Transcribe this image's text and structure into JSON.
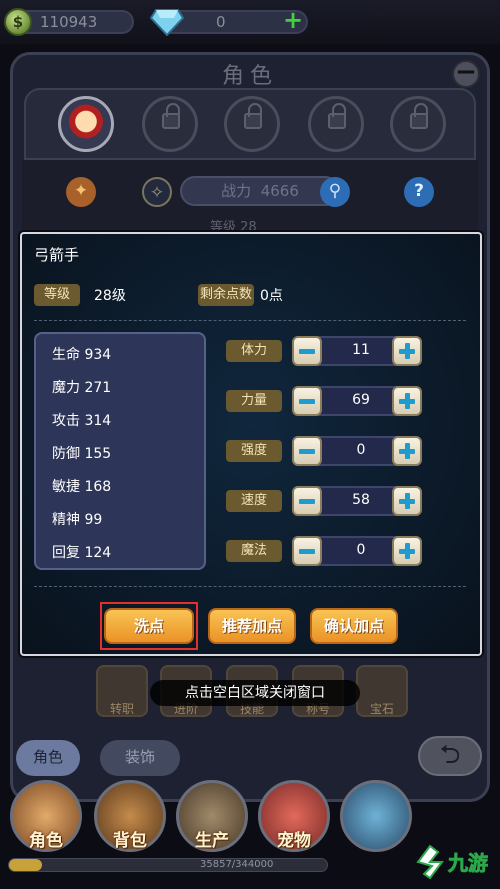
{
  "currency": {
    "gold": "110943",
    "gems": "0",
    "add": "+"
  },
  "background": {
    "title": "角色",
    "power_label": "战力",
    "power_value": "4666",
    "level_peek": "等级 28",
    "skills": [
      "转职",
      "进阶",
      "技能",
      "称号",
      "宝石"
    ],
    "tabs": {
      "character": "角色",
      "outfit": "装饰"
    },
    "nav": [
      "角色",
      "背包",
      "生产",
      "宠物"
    ],
    "exp_text": "35857/344000",
    "exp_fraction": 0.104
  },
  "modal": {
    "title": "弓箭手",
    "level_label": "等级",
    "level_value": "28级",
    "points_label": "剩余点数",
    "points_value": "0点",
    "stats": [
      {
        "text": "生命 934"
      },
      {
        "text": "魔力 271"
      },
      {
        "text": "攻击 314"
      },
      {
        "text": "防御 155"
      },
      {
        "text": "敏捷 168"
      },
      {
        "text": "精神 99"
      },
      {
        "text": "回复 124"
      }
    ],
    "attributes": [
      {
        "label": "体力",
        "value": "11"
      },
      {
        "label": "力量",
        "value": "69"
      },
      {
        "label": "强度",
        "value": "0"
      },
      {
        "label": "速度",
        "value": "58"
      },
      {
        "label": "魔法",
        "value": "0"
      }
    ],
    "buttons": {
      "reset": "洗点",
      "recommend": "推荐加点",
      "confirm": "确认加点"
    }
  },
  "hint": "点击空白区域关闭窗口",
  "colors": {
    "accent_gold": "#eb9226",
    "tag_brown": "#6b5a2f",
    "plus_blue": "#1f9bd0",
    "highlight_red": "#e0312d"
  }
}
